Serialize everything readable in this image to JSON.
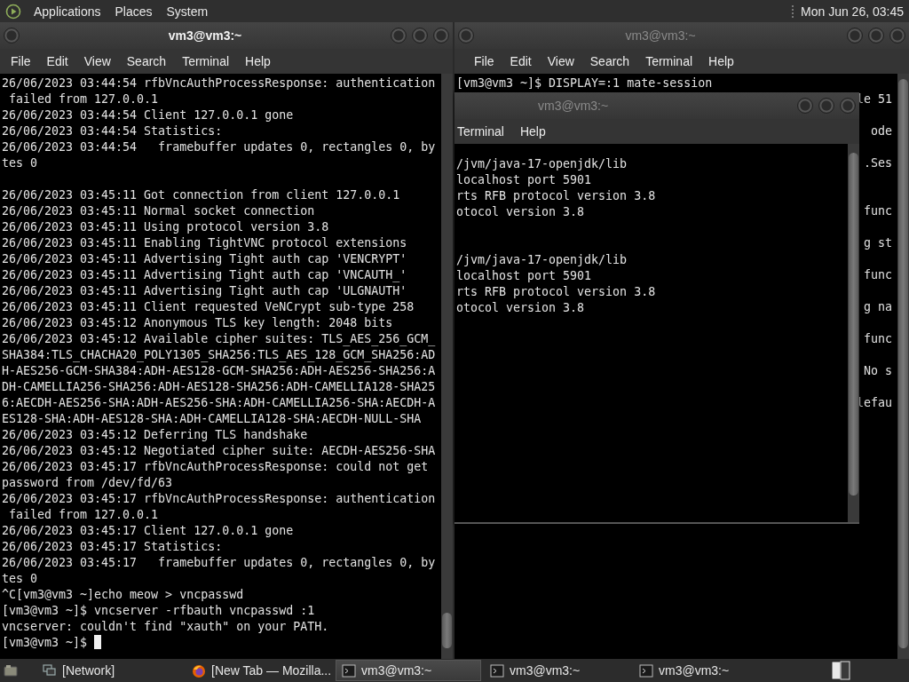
{
  "top_panel": {
    "menus": [
      "Applications",
      "Places",
      "System"
    ],
    "clock": "Mon Jun 26, 03:45"
  },
  "left_terminal": {
    "title": "vm3@vm3:~",
    "active": true,
    "menus": [
      "File",
      "Edit",
      "View",
      "Search",
      "Terminal",
      "Help"
    ],
    "cursor": true,
    "lines": [
      {
        "kind": "text",
        "text": "26/06/2023 03:44:54 rfbVncAuthProcessResponse: authentication"
      },
      {
        "kind": "text",
        "text": " failed from 127.0.0.1"
      },
      {
        "kind": "text",
        "text": "26/06/2023 03:44:54 Client 127.0.0.1 gone"
      },
      {
        "kind": "text",
        "text": "26/06/2023 03:44:54 Statistics:"
      },
      {
        "kind": "text",
        "text": "26/06/2023 03:44:54   framebuffer updates 0, rectangles 0, by"
      },
      {
        "kind": "text",
        "text": "tes 0"
      },
      {
        "kind": "blank"
      },
      {
        "kind": "text",
        "text": "26/06/2023 03:45:11 Got connection from client 127.0.0.1"
      },
      {
        "kind": "text",
        "text": "26/06/2023 03:45:11 Normal socket connection"
      },
      {
        "kind": "text",
        "text": "26/06/2023 03:45:11 Using protocol version 3.8"
      },
      {
        "kind": "text",
        "text": "26/06/2023 03:45:11 Enabling TightVNC protocol extensions"
      },
      {
        "kind": "text",
        "text": "26/06/2023 03:45:11 Advertising Tight auth cap 'VENCRYPT'"
      },
      {
        "kind": "text",
        "text": "26/06/2023 03:45:11 Advertising Tight auth cap 'VNCAUTH_'"
      },
      {
        "kind": "text",
        "text": "26/06/2023 03:45:11 Advertising Tight auth cap 'ULGNAUTH'"
      },
      {
        "kind": "text",
        "text": "26/06/2023 03:45:11 Client requested VeNCrypt sub-type 258"
      },
      {
        "kind": "text",
        "text": "26/06/2023 03:45:12 Anonymous TLS key length: 2048 bits"
      },
      {
        "kind": "text",
        "text": "26/06/2023 03:45:12 Available cipher suites: TLS_AES_256_GCM_"
      },
      {
        "kind": "text",
        "text": "SHA384:TLS_CHACHA20_POLY1305_SHA256:TLS_AES_128_GCM_SHA256:AD"
      },
      {
        "kind": "text",
        "text": "H-AES256-GCM-SHA384:ADH-AES128-GCM-SHA256:ADH-AES256-SHA256:A"
      },
      {
        "kind": "text",
        "text": "DH-CAMELLIA256-SHA256:ADH-AES128-SHA256:ADH-CAMELLIA128-SHA25"
      },
      {
        "kind": "text",
        "text": "6:AECDH-AES256-SHA:ADH-AES256-SHA:ADH-CAMELLIA256-SHA:AECDH-A"
      },
      {
        "kind": "text",
        "text": "ES128-SHA:ADH-AES128-SHA:ADH-CAMELLIA128-SHA:AECDH-NULL-SHA"
      },
      {
        "kind": "text",
        "text": "26/06/2023 03:45:12 Deferring TLS handshake"
      },
      {
        "kind": "text",
        "text": "26/06/2023 03:45:12 Negotiated cipher suite: AECDH-AES256-SHA"
      },
      {
        "kind": "text",
        "text": "26/06/2023 03:45:17 rfbVncAuthProcessResponse: could not get"
      },
      {
        "kind": "text",
        "text": "password from /dev/fd/63"
      },
      {
        "kind": "text",
        "text": "26/06/2023 03:45:17 rfbVncAuthProcessResponse: authentication"
      },
      {
        "kind": "text",
        "text": " failed from 127.0.0.1"
      },
      {
        "kind": "text",
        "text": "26/06/2023 03:45:17 Client 127.0.0.1 gone"
      },
      {
        "kind": "text",
        "text": "26/06/2023 03:45:17 Statistics:"
      },
      {
        "kind": "text",
        "text": "26/06/2023 03:45:17   framebuffer updates 0, rectangles 0, by"
      },
      {
        "kind": "text",
        "text": "tes 0"
      },
      {
        "kind": "text",
        "text": "^C[vm3@vm3 ~]echo meow > vncpasswd"
      },
      {
        "kind": "text",
        "text": "[vm3@vm3 ~]$ vncserver -rfbauth vncpasswd :1"
      },
      {
        "kind": "text",
        "text": "vncserver: couldn't find \"xauth\" on your PATH."
      },
      {
        "kind": "text",
        "text": "[vm3@vm3 ~]$ "
      }
    ]
  },
  "right_terminal": {
    "title": "vm3@vm3:~",
    "active": false,
    "menus": [
      "File",
      "Edit",
      "View",
      "Search",
      "Terminal",
      "Help"
    ],
    "lines": [
      {
        "kind": "text",
        "text": "[vm3@vm3 ~]$ DISPLAY=:1 mate-session"
      },
      {
        "kind": "tail",
        "text": "le 51"
      },
      {
        "kind": "blank"
      },
      {
        "kind": "tail",
        "text": "ode"
      },
      {
        "kind": "blank"
      },
      {
        "kind": "tail",
        "text": ".Ses"
      },
      {
        "kind": "blank"
      },
      {
        "kind": "blank"
      },
      {
        "kind": "tail",
        "text": "func"
      },
      {
        "kind": "blank"
      },
      {
        "kind": "tail",
        "text": "g st"
      },
      {
        "kind": "blank"
      },
      {
        "kind": "tail",
        "text": "func"
      },
      {
        "kind": "blank"
      },
      {
        "kind": "tail",
        "text": "g na"
      },
      {
        "kind": "blank"
      },
      {
        "kind": "tail",
        "text": "func"
      },
      {
        "kind": "blank"
      },
      {
        "kind": "tail",
        "text": "No s"
      },
      {
        "kind": "blank"
      },
      {
        "kind": "tail",
        "text": "lefau"
      }
    ]
  },
  "middle_terminal": {
    "title": "vm3@vm3:~",
    "active": false,
    "menus": [
      "Terminal",
      "Help"
    ],
    "lines": [
      {
        "kind": "text",
        "text": "/jvm/java-17-openjdk/lib"
      },
      {
        "kind": "text",
        "text": "localhost port 5901"
      },
      {
        "kind": "text",
        "text": "rts RFB protocol version 3.8"
      },
      {
        "kind": "text",
        "text": "otocol version 3.8"
      },
      {
        "kind": "blank"
      },
      {
        "kind": "blank"
      },
      {
        "kind": "text",
        "text": "/jvm/java-17-openjdk/lib"
      },
      {
        "kind": "text",
        "text": "localhost port 5901"
      },
      {
        "kind": "text",
        "text": "rts RFB protocol version 3.8"
      },
      {
        "kind": "text",
        "text": "otocol version 3.8"
      }
    ]
  },
  "taskbar": {
    "items": [
      {
        "kind": "network",
        "label": "[Network]",
        "selected": false
      },
      {
        "kind": "browser",
        "label": "[New Tab — Mozilla...",
        "selected": false
      },
      {
        "kind": "terminal",
        "label": "vm3@vm3:~",
        "selected": true
      },
      {
        "kind": "terminal",
        "label": "vm3@vm3:~",
        "selected": false
      },
      {
        "kind": "terminal",
        "label": "vm3@vm3:~",
        "selected": false
      }
    ]
  }
}
